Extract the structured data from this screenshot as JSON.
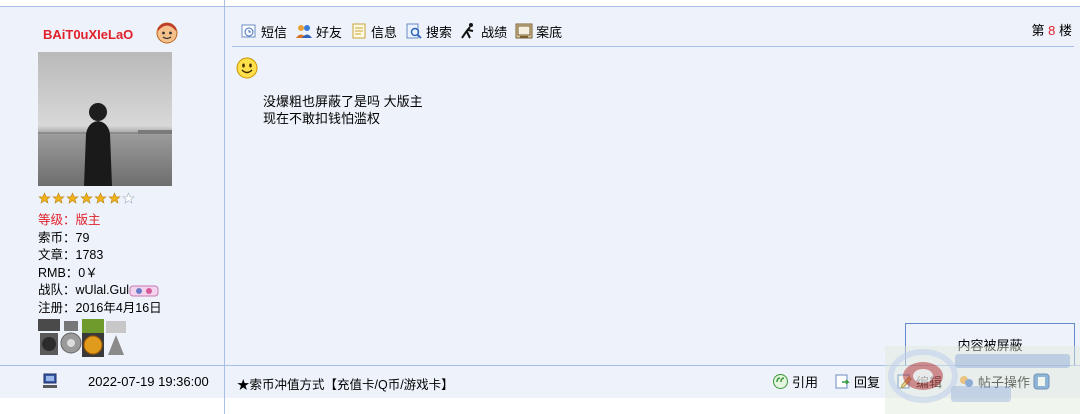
{
  "user": {
    "name": "BAiT0uXIeLaO",
    "rating_stars": 6,
    "rating_max": 7,
    "level_label": "等级：",
    "level_value": "版主",
    "coins_label": "索币：",
    "coins_value": "79",
    "posts_label": "文章：",
    "posts_value": "1783",
    "rmb_label": "RMB：",
    "rmb_value": "0￥",
    "team_label": "战队：",
    "team_value": "wUlal.Gul",
    "register_label": "注册：",
    "register_value": "2016年4月16日"
  },
  "toolbar": {
    "items": [
      {
        "label": "短信",
        "icon": "message-icon"
      },
      {
        "label": "好友",
        "icon": "friends-icon"
      },
      {
        "label": "信息",
        "icon": "info-icon"
      },
      {
        "label": "搜索",
        "icon": "search-icon"
      },
      {
        "label": "战绩",
        "icon": "record-icon"
      },
      {
        "label": "案底",
        "icon": "file-icon"
      }
    ],
    "floor_prefix": "第",
    "floor_number": "8",
    "floor_suffix": "楼"
  },
  "post": {
    "lines": [
      "没爆粗也屏蔽了是吗 大版主",
      "现在不敢扣钱怕滥权"
    ]
  },
  "blocked_label": "内容被屏蔽",
  "footer": {
    "timestamp": "2022-07-19 19:36:00",
    "ad_text": "★索币冲值方式【充值卡/Q币/游戏卡】",
    "actions": [
      {
        "label": "引用",
        "icon": "quote-icon"
      },
      {
        "label": "回复",
        "icon": "reply-icon"
      },
      {
        "label": "编辑",
        "icon": "edit-icon"
      },
      {
        "label": "帖子操作",
        "icon": "post-actions-icon"
      }
    ]
  },
  "colors": {
    "panel_bg": "#eef3fb",
    "border": "#a8c0e8",
    "accent_red": "#e0202a"
  }
}
